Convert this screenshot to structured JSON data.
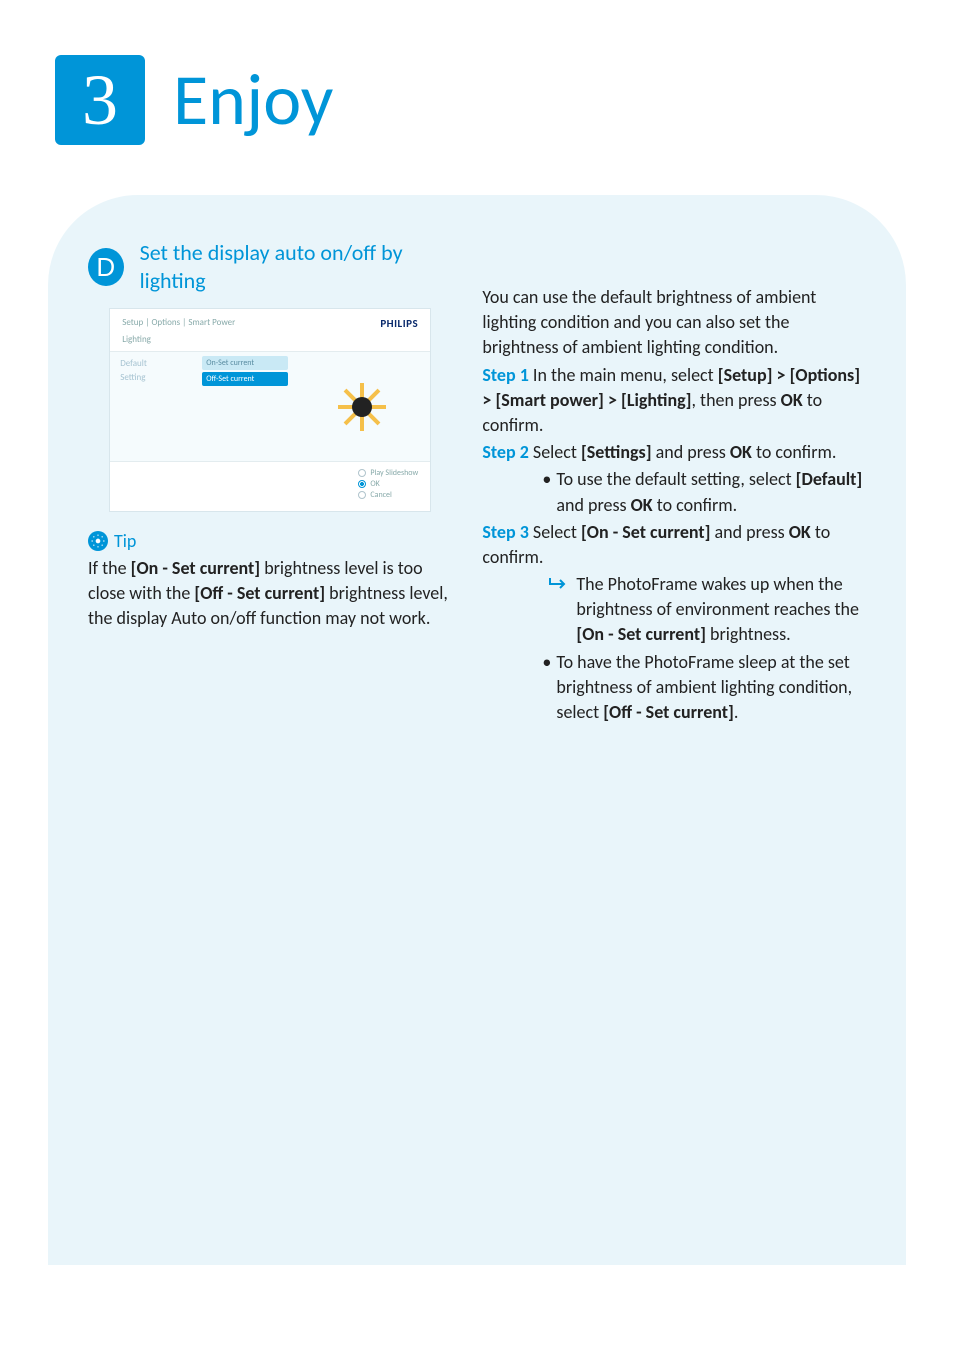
{
  "header": {
    "step_number": "3",
    "title": "Enjoy"
  },
  "section": {
    "badge": "D",
    "subtitle": "Set the display auto on/off by lighting"
  },
  "screenshot": {
    "breadcrumb": "Setup | Options | Smart Power",
    "brand": "PHILIPS",
    "subheader": "Lighting",
    "col1": [
      "Default",
      "Setting"
    ],
    "col2": [
      {
        "label": "On-Set current",
        "selected": false
      },
      {
        "label": "Off-Set current",
        "selected": true
      }
    ],
    "footer_options": [
      {
        "label": "Play Slideshow",
        "selected": false
      },
      {
        "label": "OK",
        "selected": true
      },
      {
        "label": "Cancel",
        "selected": false
      }
    ]
  },
  "tip": {
    "label": "Tip",
    "body_parts": {
      "p1": "If the ",
      "b1": "[On - Set current]",
      "p2": " brightness level is too close with the ",
      "b2": "[Off - Set current]",
      "p3": " brightness level, the display Auto on/off function may not work."
    }
  },
  "instructions": {
    "intro": "You can use the default brightness of ambient lighting condition and you can also set the brightness of ambient lighting condition.",
    "step1": {
      "label": "Step 1",
      "t1": " In the main menu, select ",
      "b1": "[Setup] > [Options] > [Smart power] > [Lighting]",
      "t2": ", then press ",
      "b2": "OK",
      "t3": " to confirm."
    },
    "step2": {
      "label": "Step 2",
      "t1": " Select ",
      "b1": "[Settings]",
      "t2": " and press ",
      "b2": "OK",
      "t3": " to confirm."
    },
    "step2_bullet": {
      "t1": "To use the default setting, select ",
      "b1": "[Default]",
      "t2": " and press ",
      "b2": "OK",
      "t3": " to confirm."
    },
    "step3": {
      "label": "Step 3",
      "t1": " Select ",
      "b1": "[On - Set current]",
      "t2": " and press ",
      "b2": "OK",
      "t3": " to confirm."
    },
    "step3_arrow": {
      "t1": "The PhotoFrame wakes up when the brightness of environment reaches the ",
      "b1": "[On - Set current]",
      "t2": " brightness."
    },
    "step3_bullet": {
      "t1": "To have the PhotoFrame sleep at the set brightness of ambient lighting condition, select ",
      "b1": "[Off - Set current]",
      "t2": "."
    }
  }
}
